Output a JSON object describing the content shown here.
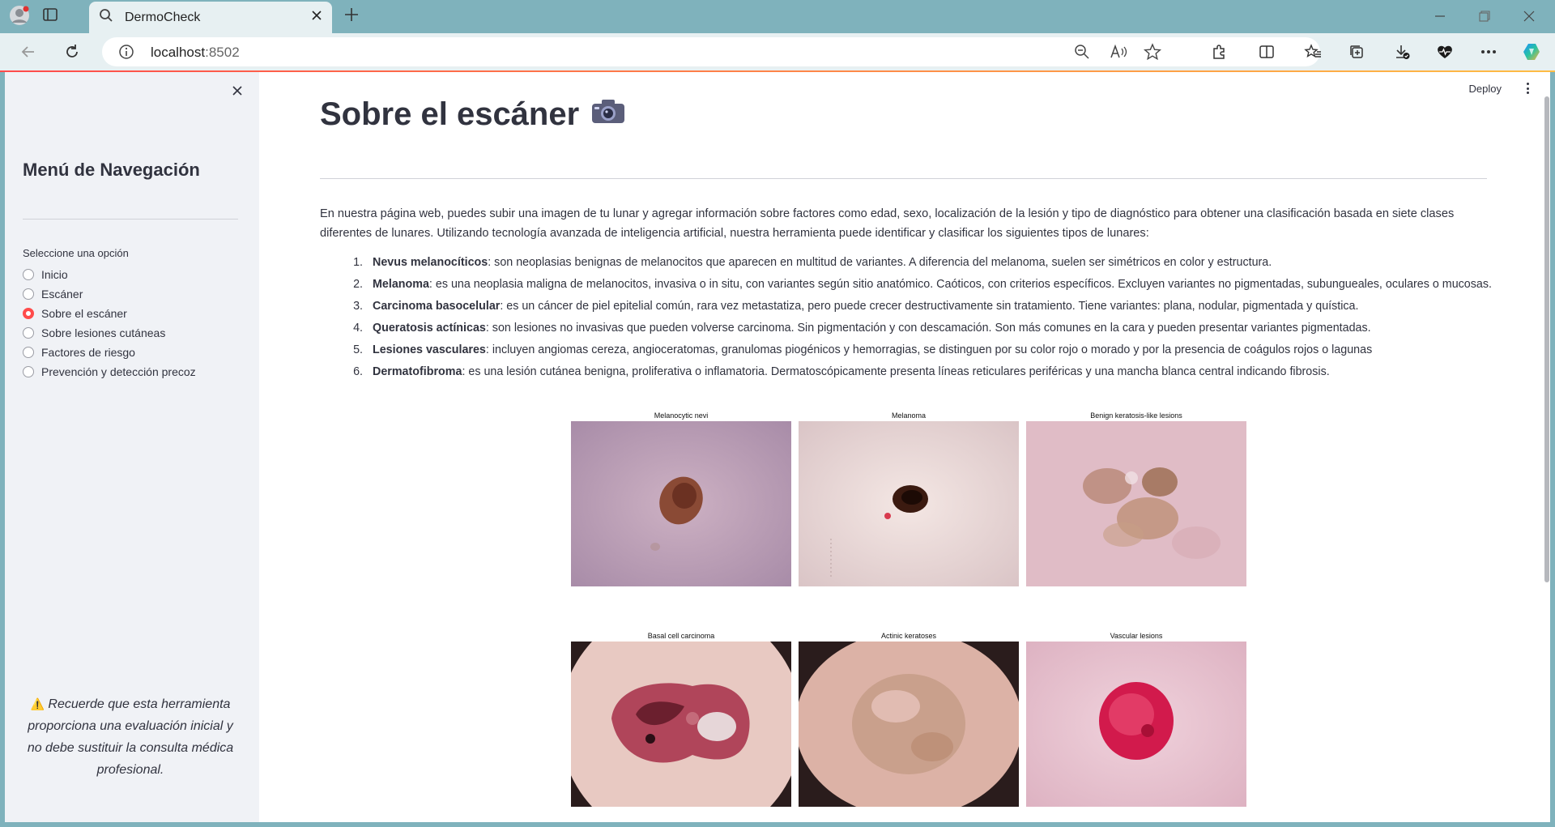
{
  "browser": {
    "tab_title": "DermoCheck",
    "url_host": "localhost",
    "url_port": ":8502"
  },
  "sidebar": {
    "heading": "Menú de Navegación",
    "radio_label": "Seleccione una opción",
    "options": [
      {
        "label": "Inicio",
        "selected": false
      },
      {
        "label": "Escáner",
        "selected": false
      },
      {
        "label": "Sobre el escáner",
        "selected": true
      },
      {
        "label": "Sobre lesiones cutáneas",
        "selected": false
      },
      {
        "label": "Factores de riesgo",
        "selected": false
      },
      {
        "label": "Prevención y detección precoz",
        "selected": false
      }
    ],
    "note_icon": "⚠️",
    "note": "Recuerde que esta herramienta proporciona una evaluación inicial y no debe sustituir la consulta médica profesional."
  },
  "header": {
    "deploy_label": "Deploy"
  },
  "main": {
    "title": "Sobre el escáner",
    "title_icon": "📷",
    "intro": "En nuestra página web, puedes subir una imagen de tu lunar y agregar información sobre factores como edad, sexo, localización de la lesión y tipo de diagnóstico para obtener una clasificación basada en siete clases diferentes de lunares. Utilizando tecnología avanzada de inteligencia artificial, nuestra herramienta puede identificar y clasificar los siguientes tipos de lunares:",
    "lesions": [
      {
        "num": "1.",
        "name": "Nevus melanocíticos",
        "desc": ": son neoplasias benignas de melanocitos que aparecen en multitud de variantes. A diferencia del melanoma, suelen ser simétricos en color y estructura."
      },
      {
        "num": "2.",
        "name": "Melanoma",
        "desc": ": es una neoplasia maligna de melanocitos, invasiva o in situ, con variantes según sitio anatómico. Caóticos, con criterios específicos. Excluyen variantes no pigmentadas, subungueales, oculares o mucosas."
      },
      {
        "num": "3.",
        "name": "Carcinoma basocelular",
        "desc": ": es un cáncer de piel epitelial común, rara vez metastatiza, pero puede crecer destructivamente sin tratamiento. Tiene variantes: plana, nodular, pigmentada y quística."
      },
      {
        "num": "4.",
        "name": "Queratosis actínicas",
        "desc": ": son lesiones no invasivas que pueden volverse carcinoma. Sin pigmentación y con descamación. Son más comunes en la cara y pueden presentar variantes pigmentadas."
      },
      {
        "num": "5.",
        "name": "Lesiones vasculares",
        "desc": ": incluyen angiomas cereza, angioceratomas, granulomas piogénicos y hemorragias, se distinguen por su color rojo o morado y por la presencia de coágulos rojos o lagunas"
      },
      {
        "num": "6.",
        "name": "Dermatofibroma",
        "desc": ": es una lesión cutánea benigna, proliferativa o inflamatoria. Dermatoscópicamente presenta líneas reticulares periféricas y una mancha blanca central indicando fibrosis."
      }
    ],
    "images": [
      {
        "caption": "Melanocytic nevi"
      },
      {
        "caption": "Melanoma"
      },
      {
        "caption": "Benign keratosis-like lesions"
      },
      {
        "caption": "Basal cell carcinoma"
      },
      {
        "caption": "Actinic keratoses"
      },
      {
        "caption": "Vascular lesions"
      }
    ]
  },
  "colors": {
    "accent": "#ff4b4b",
    "sidebar_bg": "#f0f2f6",
    "text": "#31333f",
    "chrome": "#7fb2bc"
  }
}
